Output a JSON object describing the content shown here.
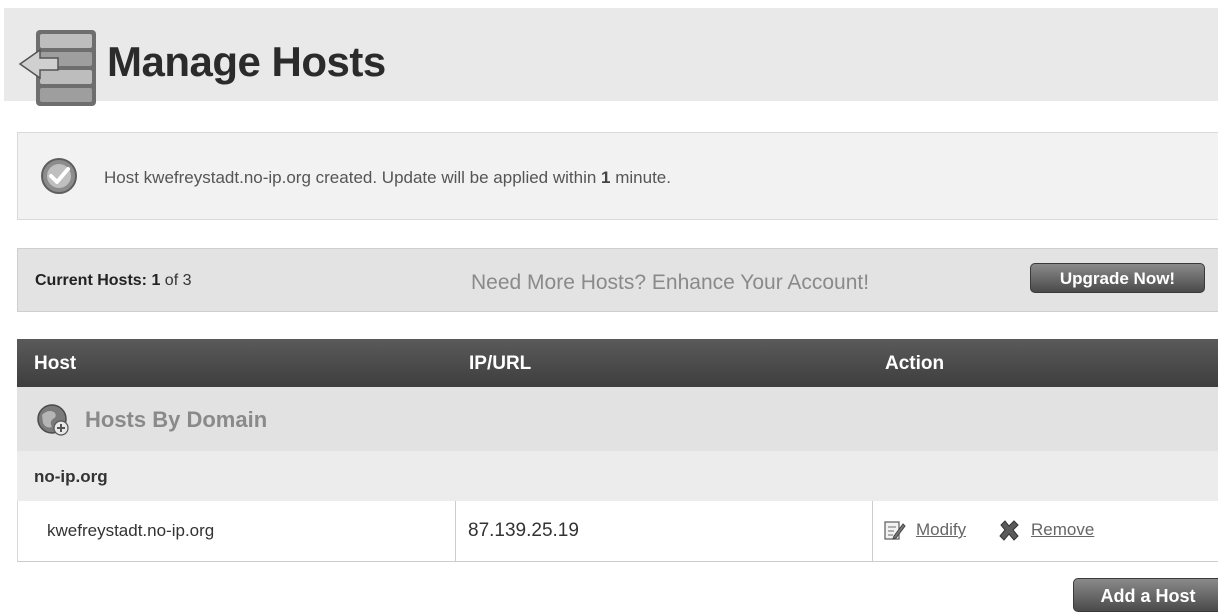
{
  "header": {
    "title": "Manage Hosts",
    "icon": "server-stack-icon"
  },
  "notice": {
    "icon": "check-circle-icon",
    "prefix": "Host kwefreystadt.no-ip.org created. Update will be applied within ",
    "bold": "1",
    "suffix": " minute."
  },
  "host_bar": {
    "label": "Current Hosts: ",
    "current": "1",
    "total_text": " of 3",
    "promo": "Need More Hosts? Enhance Your Account!",
    "upgrade_label": "Upgrade Now!"
  },
  "table": {
    "columns": [
      "Host",
      "IP/URL",
      "Action"
    ],
    "group_label": "Hosts By Domain",
    "group_icon": "globe-add-icon",
    "domain": "no-ip.org",
    "rows": [
      {
        "host": "kwefreystadt.no-ip.org",
        "ip": "87.139.25.19",
        "modify": "Modify",
        "remove": "Remove"
      }
    ]
  },
  "add_host_label": "Add a Host"
}
